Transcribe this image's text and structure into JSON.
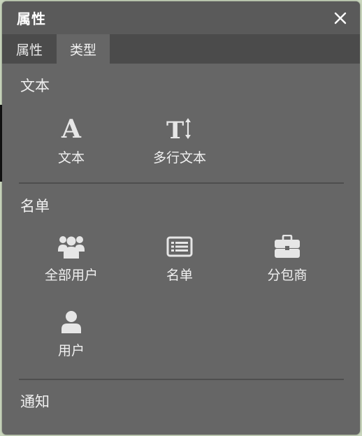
{
  "dialog": {
    "title": "属性",
    "close_glyph": "✕"
  },
  "tabs": [
    {
      "label": "属性",
      "active": false
    },
    {
      "label": "类型",
      "active": true
    }
  ],
  "sections": [
    {
      "title": "文本",
      "items": [
        {
          "label": "文本",
          "icon": "text-icon",
          "glyph": "A"
        },
        {
          "label": "多行文本",
          "icon": "multiline-text-icon",
          "glyph": "T"
        }
      ]
    },
    {
      "title": "名单",
      "items": [
        {
          "label": "全部用户",
          "icon": "users-group-icon"
        },
        {
          "label": "名单",
          "icon": "list-icon"
        },
        {
          "label": "分包商",
          "icon": "briefcase-icon"
        },
        {
          "label": "用户",
          "icon": "user-icon"
        }
      ]
    },
    {
      "title": "通知",
      "items": []
    }
  ],
  "colors": {
    "panel_bg": "#666666",
    "titlebar_bg": "#5a5a5a",
    "tabbar_bg": "#4b4b4b",
    "text": "#f0f0f0",
    "icon": "#e6e6e6"
  }
}
